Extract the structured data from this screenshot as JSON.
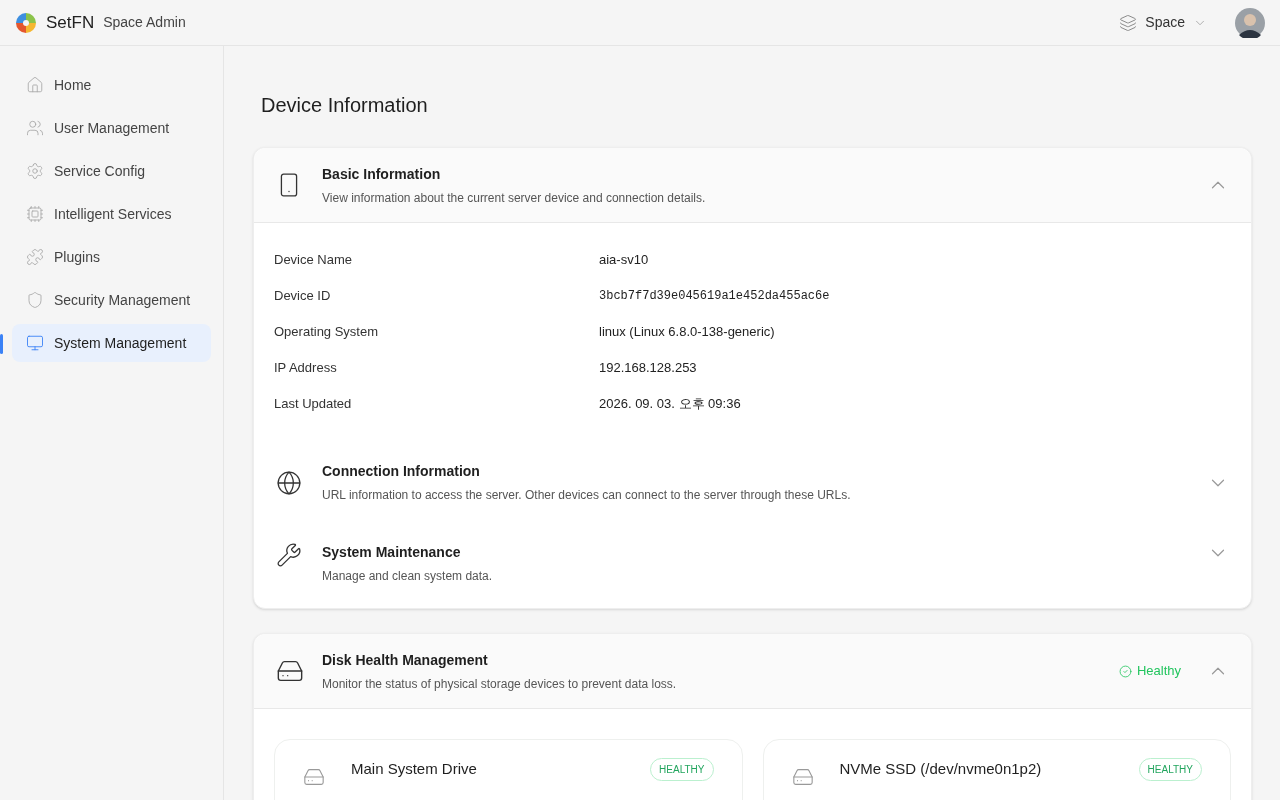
{
  "header": {
    "brand": "SetFN",
    "product": "Space Admin",
    "space": "Space"
  },
  "sidebar": {
    "items": [
      {
        "label": "Home",
        "selected": false
      },
      {
        "label": "User Management",
        "selected": false
      },
      {
        "label": "Service Config",
        "selected": false
      },
      {
        "label": "Intelligent Services",
        "selected": false
      },
      {
        "label": "Plugins",
        "selected": false
      },
      {
        "label": "Security Management",
        "selected": false
      },
      {
        "label": "System Management",
        "selected": true
      }
    ]
  },
  "page_title": "Device Information",
  "sections": [
    {
      "title": "Basic Information",
      "description": "View information about the current server device and connection details.",
      "expanded": true,
      "fields": [
        {
          "label": "Device Name",
          "value": "aia-sv10",
          "kind": "text"
        },
        {
          "label": "Device ID",
          "value": "3bcb7f7d39e045619a1e452da455ac6e",
          "kind": "code"
        },
        {
          "label": "Operating System",
          "value": "linux (Linux 6.8.0-138-generic)",
          "kind": "text"
        },
        {
          "label": "IP Address",
          "value": "192.168.128.253",
          "kind": "text"
        },
        {
          "label": "Last Updated",
          "value": "2026. 09. 03. 오후 09:36",
          "kind": "text"
        }
      ]
    },
    {
      "title": "Connection Information",
      "description": "URL information to access the server. Other devices can connect to the server through these URLs.",
      "expanded": false
    },
    {
      "title": "System Maintenance",
      "description": "Manage and clean system data.",
      "expanded": false
    }
  ],
  "disk_health": {
    "title": "Disk Health Management",
    "description": "Monitor the status of physical storage devices to prevent data loss.",
    "status": "Healthy",
    "expanded": true,
    "disks": [
      {
        "name": "Main System Drive",
        "badge": "HEALTHY"
      },
      {
        "name": "NVMe SSD (/dev/nvme0n1p2)",
        "badge": "HEALTHY"
      }
    ]
  }
}
